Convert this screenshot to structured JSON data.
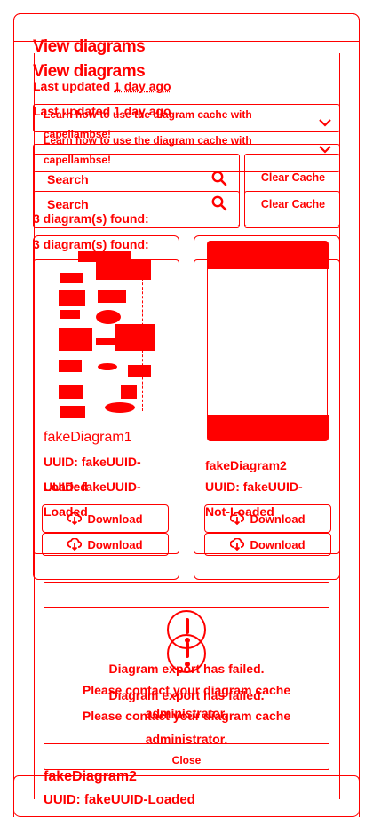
{
  "header": {
    "title": "View diagrams",
    "last_updated_prefix": "Last updated",
    "last_updated_ago": "1 day ago"
  },
  "info": {
    "text": "Learn how to use the diagram cache with capellambse!",
    "expand_icon": "chevron-down-icon"
  },
  "search": {
    "placeholder": "Search",
    "icon": "search-icon",
    "clear_label": "Clear Cache"
  },
  "results": {
    "found_text": "3 diagram(s) found:"
  },
  "cards": [
    {
      "name": "fakeDiagram1",
      "uuid_text": "UUID: fakeUUID-Loaded",
      "download_label": "Download",
      "download_icon": "cloud-download-icon"
    },
    {
      "name": "fakeDiagram2",
      "uuid_text": "UUID: fakeUUID-Not-Loaded",
      "download_label": "Download",
      "download_icon": "cloud-download-icon"
    },
    {
      "name": "fakeDiagram2",
      "uuid_text": "UUID: fakeUUID-Loaded"
    }
  ],
  "modal": {
    "icon": "exclamation-circle-icon",
    "title": "Diagram export has failed.",
    "message": "Please contact your diagram cache administrator.",
    "close_label": "Close"
  },
  "colors": {
    "accent": "#ff0000",
    "background": "#ffffff"
  }
}
